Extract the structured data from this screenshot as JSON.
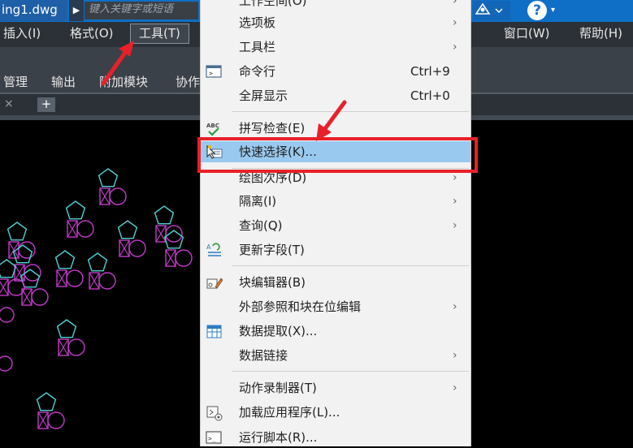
{
  "titlebar": {
    "file_tab": "ing1.dwg",
    "play_glyph": "▶",
    "search_placeholder": "键入关键字或短语",
    "user_icon": "user-icon",
    "help_glyph": "?",
    "help_caret": "▾"
  },
  "menubar": {
    "items": [
      {
        "label": "插入(I)"
      },
      {
        "label": "格式(O)"
      },
      {
        "label": "工具(T)"
      },
      {
        "label": "窗口(W)"
      },
      {
        "label": "帮助(H)"
      }
    ]
  },
  "ribbon": {
    "tabs": [
      {
        "label": "管理"
      },
      {
        "label": "输出"
      },
      {
        "label": "附加模块"
      },
      {
        "label": "协作"
      }
    ]
  },
  "docbar": {
    "close_glyph": "×",
    "add_glyph": "+"
  },
  "context_menu": {
    "items": [
      {
        "label": "工作空间(O)",
        "shortcut": "",
        "submenu": true,
        "icon": ""
      },
      {
        "label": "选项板",
        "shortcut": "",
        "submenu": true,
        "icon": ""
      },
      {
        "label": "工具栏",
        "shortcut": "",
        "submenu": true,
        "icon": ""
      },
      {
        "label": "命令行",
        "shortcut": "Ctrl+9",
        "submenu": false,
        "icon": "command-line-icon"
      },
      {
        "label": "全屏显示",
        "shortcut": "Ctrl+0",
        "submenu": false,
        "icon": ""
      },
      {
        "label": "拼写检查(E)",
        "shortcut": "",
        "submenu": false,
        "icon": "spell-check-icon"
      },
      {
        "label": "快速选择(K)...",
        "shortcut": "",
        "submenu": false,
        "icon": "quick-select-icon",
        "highlighted": true
      },
      {
        "label": "绘图次序(D)",
        "shortcut": "",
        "submenu": true,
        "icon": ""
      },
      {
        "label": "隔离(I)",
        "shortcut": "",
        "submenu": true,
        "icon": ""
      },
      {
        "label": "查询(Q)",
        "shortcut": "",
        "submenu": true,
        "icon": ""
      },
      {
        "label": "更新字段(T)",
        "shortcut": "",
        "submenu": false,
        "icon": "update-fields-icon"
      },
      {
        "label": "块编辑器(B)",
        "shortcut": "",
        "submenu": false,
        "icon": "block-editor-icon"
      },
      {
        "label": "外部参照和块在位编辑",
        "shortcut": "",
        "submenu": true,
        "icon": ""
      },
      {
        "label": "数据提取(X)...",
        "shortcut": "",
        "submenu": false,
        "icon": "data-extraction-icon"
      },
      {
        "label": "数据链接",
        "shortcut": "",
        "submenu": true,
        "icon": ""
      },
      {
        "label": "动作录制器(T)",
        "shortcut": "",
        "submenu": true,
        "icon": ""
      },
      {
        "label": "加载应用程序(L)...",
        "shortcut": "",
        "submenu": false,
        "icon": "load-application-icon"
      },
      {
        "label": "运行脚本(R)...",
        "shortcut": "",
        "submenu": false,
        "icon": "run-script-icon"
      }
    ],
    "arrow_glyph": "›"
  },
  "colors": {
    "title_blue": "#0f6fc6",
    "menu_highlight": "#99c9ef",
    "annotation_red": "#e8202a",
    "cad_cyan": "#4fd3d6",
    "cad_magenta": "#c23bc9"
  }
}
